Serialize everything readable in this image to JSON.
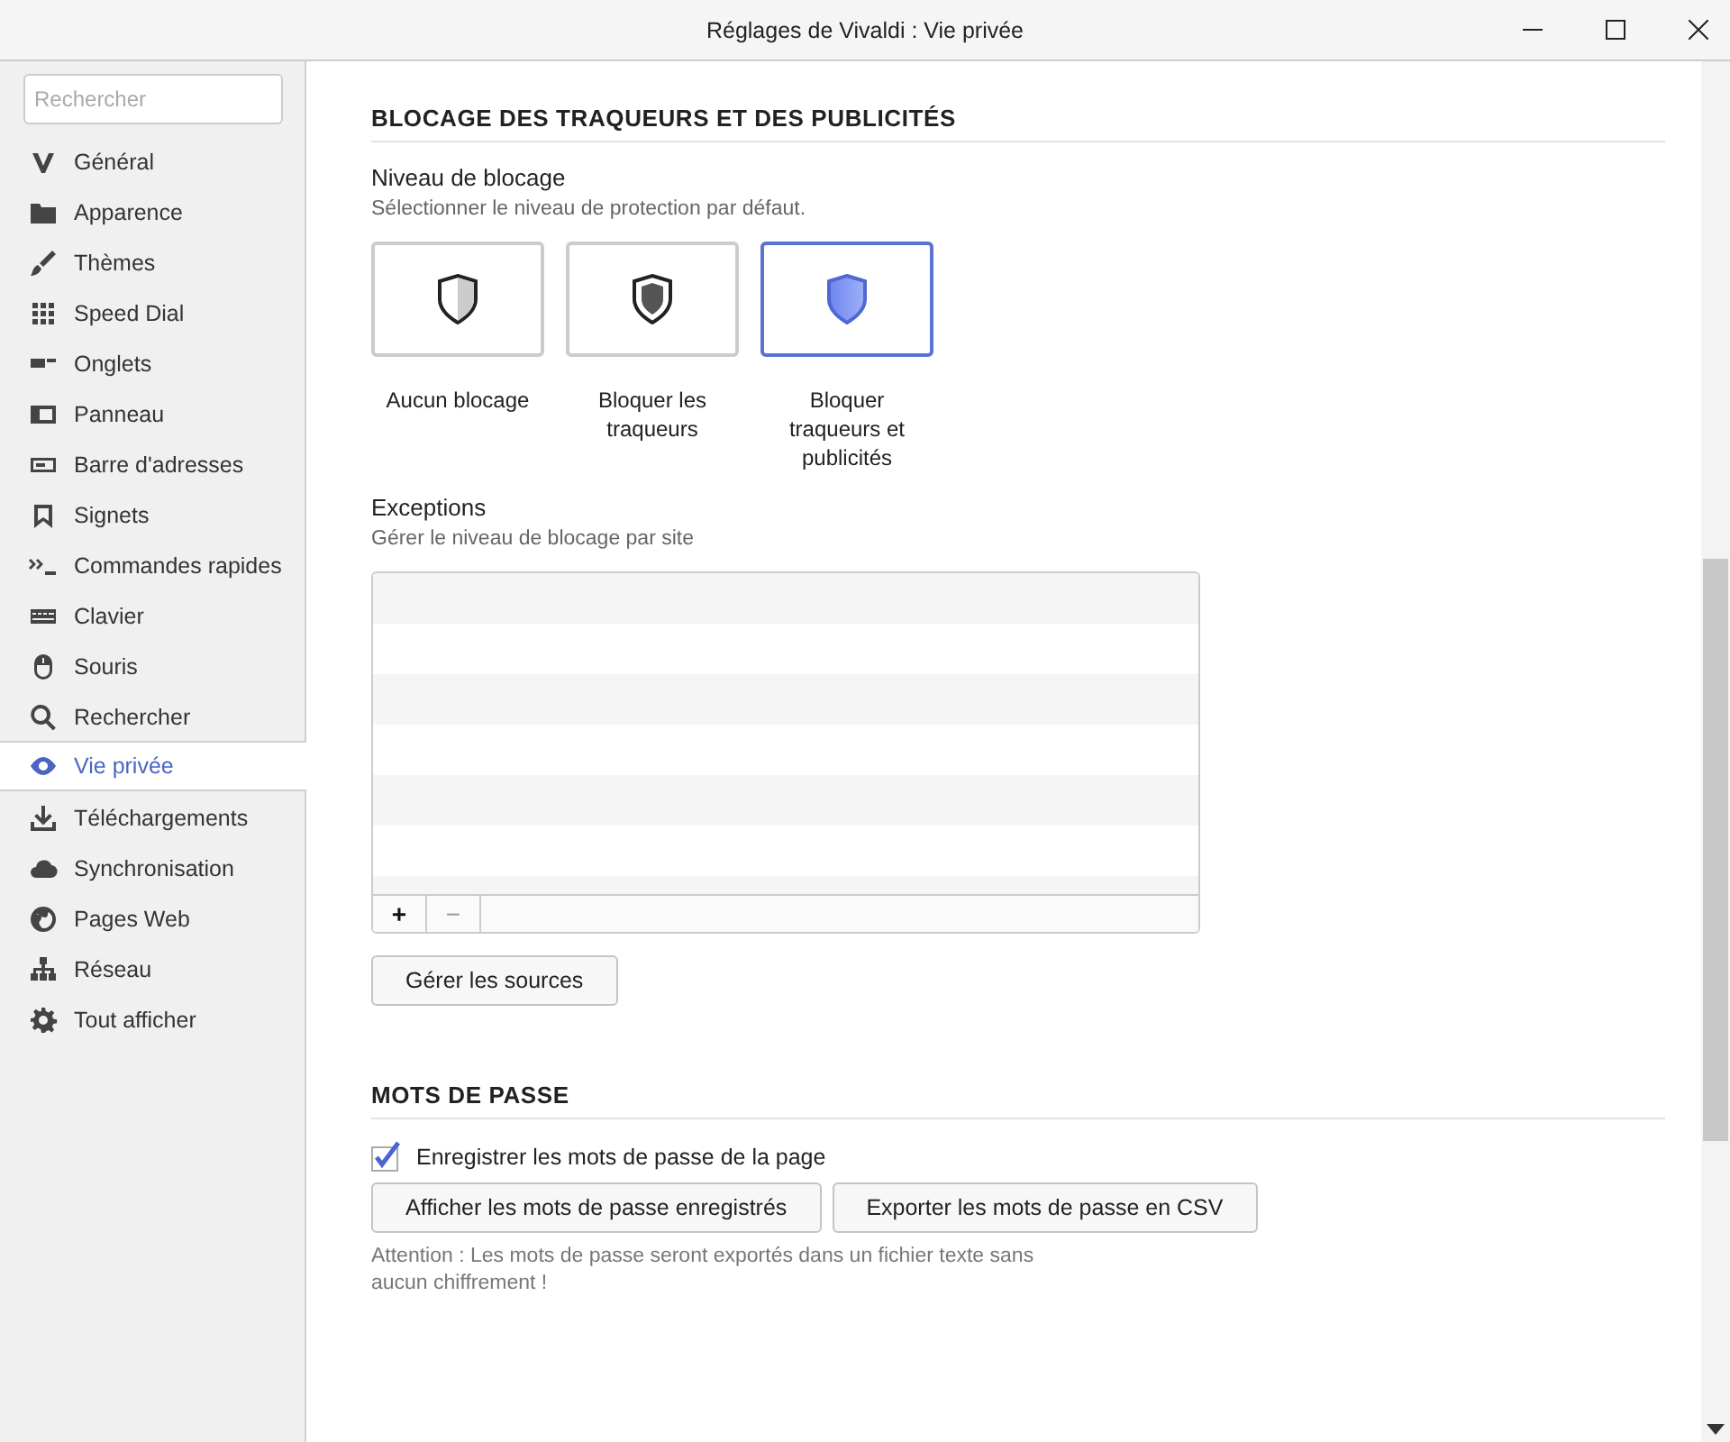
{
  "window": {
    "title": "Réglages de Vivaldi : Vie privée"
  },
  "sidebar": {
    "search": {
      "placeholder": "Rechercher"
    },
    "items": [
      {
        "label": "Général",
        "selected": false
      },
      {
        "label": "Apparence",
        "selected": false
      },
      {
        "label": "Thèmes",
        "selected": false
      },
      {
        "label": "Speed Dial",
        "selected": false
      },
      {
        "label": "Onglets",
        "selected": false
      },
      {
        "label": "Panneau",
        "selected": false
      },
      {
        "label": "Barre d'adresses",
        "selected": false
      },
      {
        "label": "Signets",
        "selected": false
      },
      {
        "label": "Commandes rapides",
        "selected": false
      },
      {
        "label": "Clavier",
        "selected": false
      },
      {
        "label": "Souris",
        "selected": false
      },
      {
        "label": "Rechercher",
        "selected": false
      },
      {
        "label": "Vie privée",
        "selected": true
      },
      {
        "label": "Téléchargements",
        "selected": false
      },
      {
        "label": "Synchronisation",
        "selected": false
      },
      {
        "label": "Pages Web",
        "selected": false
      },
      {
        "label": "Réseau",
        "selected": false
      },
      {
        "label": "Tout afficher",
        "selected": false
      }
    ]
  },
  "blocking": {
    "heading": "BLOCAGE DES TRAQUEURS ET DES PUBLICITÉS",
    "level_title": "Niveau de blocage",
    "level_hint": "Sélectionner le niveau de protection par défaut.",
    "levels": [
      {
        "label": "Aucun blocage",
        "kind": "none",
        "selected": false
      },
      {
        "label": "Bloquer les traqueurs",
        "kind": "trackers",
        "selected": false
      },
      {
        "label": "Bloquer traqueurs et publicités",
        "kind": "all",
        "selected": true
      }
    ],
    "exceptions_title": "Exceptions",
    "exceptions_hint": "Gérer le niveau de blocage par site",
    "add_button": "+",
    "remove_button": {
      "label": "−",
      "disabled": true
    },
    "sources_button": "Gérer les sources"
  },
  "passwords": {
    "heading": "MOTS DE PASSE",
    "save_checkbox": {
      "label": "Enregistrer les mots de passe de la page",
      "checked": true
    },
    "buttons": [
      "Afficher les mots de passe enregistrés",
      "Exporter les mots de passe en CSV"
    ],
    "note": "Attention : Les mots de passe seront exportés dans un fichier texte sans aucun chiffrement !"
  }
}
